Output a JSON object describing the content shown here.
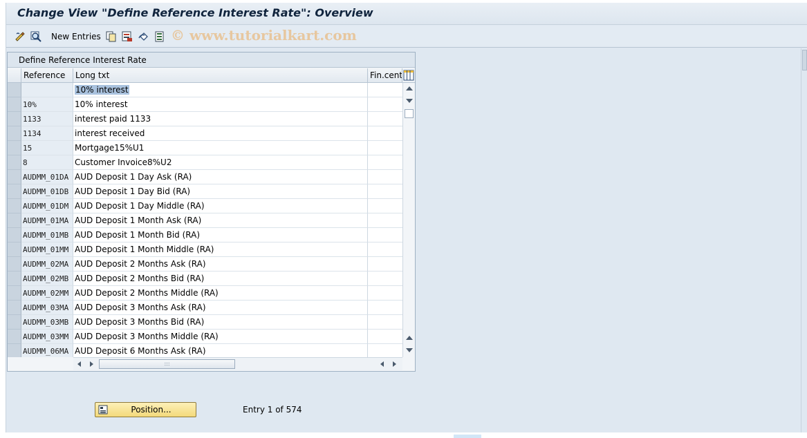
{
  "window": {
    "title": "Change View \"Define Reference Interest Rate\": Overview"
  },
  "toolbar": {
    "new_entries_label": "New Entries",
    "icons": [
      "display-change-icon",
      "details-icon",
      "copy-as-icon",
      "save-icon",
      "undo-change-icon",
      "select-all-icon"
    ]
  },
  "watermark": "© www.tutorialkart.com",
  "table": {
    "caption": "Define Reference Interest Rate",
    "columns": {
      "reference": "Reference",
      "long_txt": "Long txt",
      "fin_center": "Fin.cente"
    },
    "rows": [
      {
        "reference": "",
        "long_txt": "10% interest",
        "fin_center": ""
      },
      {
        "reference": "10%",
        "long_txt": "10% interest",
        "fin_center": ""
      },
      {
        "reference": "1133",
        "long_txt": "interest paid 1133",
        "fin_center": ""
      },
      {
        "reference": "1134",
        "long_txt": "interest received",
        "fin_center": ""
      },
      {
        "reference": "15",
        "long_txt": "Mortgage15%U1",
        "fin_center": ""
      },
      {
        "reference": "8",
        "long_txt": "Customer Invoice8%U2",
        "fin_center": ""
      },
      {
        "reference": "AUDMM_01DA",
        "long_txt": "AUD Deposit 1 Day Ask (RA)",
        "fin_center": ""
      },
      {
        "reference": "AUDMM_01DB",
        "long_txt": "AUD Deposit 1 Day Bid (RA)",
        "fin_center": ""
      },
      {
        "reference": "AUDMM_01DM",
        "long_txt": "AUD Deposit 1 Day Middle (RA)",
        "fin_center": ""
      },
      {
        "reference": "AUDMM_01MA",
        "long_txt": "AUD Deposit 1 Month Ask (RA)",
        "fin_center": ""
      },
      {
        "reference": "AUDMM_01MB",
        "long_txt": "AUD Deposit 1 Month Bid (RA)",
        "fin_center": ""
      },
      {
        "reference": "AUDMM_01MM",
        "long_txt": "AUD Deposit 1 Month Middle (RA)",
        "fin_center": ""
      },
      {
        "reference": "AUDMM_02MA",
        "long_txt": "AUD Deposit 2 Months Ask (RA)",
        "fin_center": ""
      },
      {
        "reference": "AUDMM_02MB",
        "long_txt": "AUD Deposit 2 Months Bid (RA)",
        "fin_center": ""
      },
      {
        "reference": "AUDMM_02MM",
        "long_txt": "AUD Deposit 2 Months Middle (RA)",
        "fin_center": ""
      },
      {
        "reference": "AUDMM_03MA",
        "long_txt": "AUD Deposit 3 Months Ask (RA)",
        "fin_center": ""
      },
      {
        "reference": "AUDMM_03MB",
        "long_txt": "AUD Deposit 3 Months Bid (RA)",
        "fin_center": ""
      },
      {
        "reference": "AUDMM_03MM",
        "long_txt": "AUD Deposit 3 Months Middle (RA)",
        "fin_center": ""
      },
      {
        "reference": "AUDMM_06MA",
        "long_txt": "AUD Deposit 6 Months Ask (RA)",
        "fin_center": ""
      }
    ],
    "selected_row": 0
  },
  "footer": {
    "position_button_label": "Position...",
    "entry_text": "Entry 1 of 574"
  },
  "colors": {
    "background": "#dfe8f1",
    "position_button": "#f3d97a",
    "selection_highlight": "#a9c2de"
  }
}
